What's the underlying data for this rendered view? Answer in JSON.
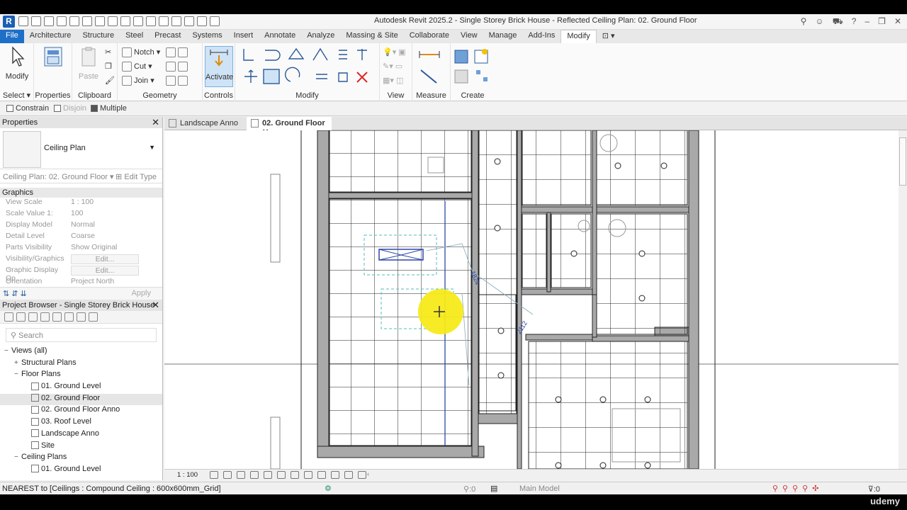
{
  "titlebar": {
    "title": "Autodesk Revit 2025.2 - Single Storey Brick House - Reflected Ceiling Plan: 02. Ground Floor"
  },
  "ribbon_tabs": [
    "File",
    "Architecture",
    "Structure",
    "Steel",
    "Precast",
    "Systems",
    "Insert",
    "Annotate",
    "Analyze",
    "Massing & Site",
    "Collaborate",
    "View",
    "Manage",
    "Add-Ins",
    "Modify"
  ],
  "ribbon": {
    "select": {
      "modify_label": "Modify",
      "panel_label": "Select"
    },
    "properties": {
      "panel_label": "Properties"
    },
    "clipboard": {
      "paste_label": "Paste",
      "panel_label": "Clipboard"
    },
    "geometry": {
      "notch_label": "Notch",
      "cut_label": "Cut",
      "join_label": "Join",
      "panel_label": "Geometry"
    },
    "controls": {
      "activate_label": "Activate",
      "panel_label": "Controls"
    },
    "modify": {
      "panel_label": "Modify"
    },
    "view": {
      "panel_label": "View"
    },
    "measure": {
      "panel_label": "Measure"
    },
    "create": {
      "panel_label": "Create"
    }
  },
  "options_bar": {
    "constrain": "Constrain",
    "disjoin": "Disjoin",
    "multiple": "Multiple"
  },
  "properties": {
    "title": "Properties",
    "type_name": "Ceiling Plan",
    "instance_label": "Ceiling Plan: 02. Ground Floor",
    "edit_type": "Edit Type",
    "group": "Graphics",
    "rows": [
      {
        "key": "View Scale",
        "value": "1 : 100"
      },
      {
        "key": "Scale Value    1:",
        "value": "100"
      },
      {
        "key": "Display Model",
        "value": "Normal"
      },
      {
        "key": "Detail Level",
        "value": "Coarse"
      },
      {
        "key": "Parts Visibility",
        "value": "Show Original"
      },
      {
        "key": "Visibility/Graphics ...",
        "value": "Edit..."
      },
      {
        "key": "Graphic Display Op...",
        "value": "Edit..."
      },
      {
        "key": "Orientation",
        "value": "Project North"
      }
    ],
    "apply": "Apply"
  },
  "project_browser": {
    "title": "Project Browser - Single Storey Brick House",
    "search_placeholder": "Search",
    "items": [
      {
        "label": "Views (all)",
        "level": 0,
        "toggle": "−"
      },
      {
        "label": "Structural Plans",
        "level": 1,
        "toggle": "+"
      },
      {
        "label": "Floor Plans",
        "level": 1,
        "toggle": "−"
      },
      {
        "label": "01. Ground Level",
        "level": 2
      },
      {
        "label": "02. Ground Floor",
        "level": 2,
        "selected": true
      },
      {
        "label": "02. Ground Floor Anno",
        "level": 2
      },
      {
        "label": "03. Roof Level",
        "level": 2
      },
      {
        "label": "Landscape Anno",
        "level": 2
      },
      {
        "label": "Site",
        "level": 2
      },
      {
        "label": "Ceiling Plans",
        "level": 1,
        "toggle": "−"
      },
      {
        "label": "01. Ground Level",
        "level": 2
      }
    ]
  },
  "drawing_tabs": [
    {
      "label": "Landscape Anno"
    },
    {
      "label": "02. Ground Floor",
      "active": true
    }
  ],
  "view_control": {
    "scale": "1 : 100"
  },
  "status_bar": {
    "message": "NEAREST  to [Ceilings : Compound Ceiling : 600x600mm_Grid]",
    "counter": ":0",
    "model": "Main Model",
    "filter": ":0"
  },
  "watermark": "udemy",
  "colors": {
    "file_tab": "#1e6fc8",
    "wall_fill": "#a9a9a9",
    "highlight": "#f7ea19",
    "selection": "#2b47a8"
  }
}
